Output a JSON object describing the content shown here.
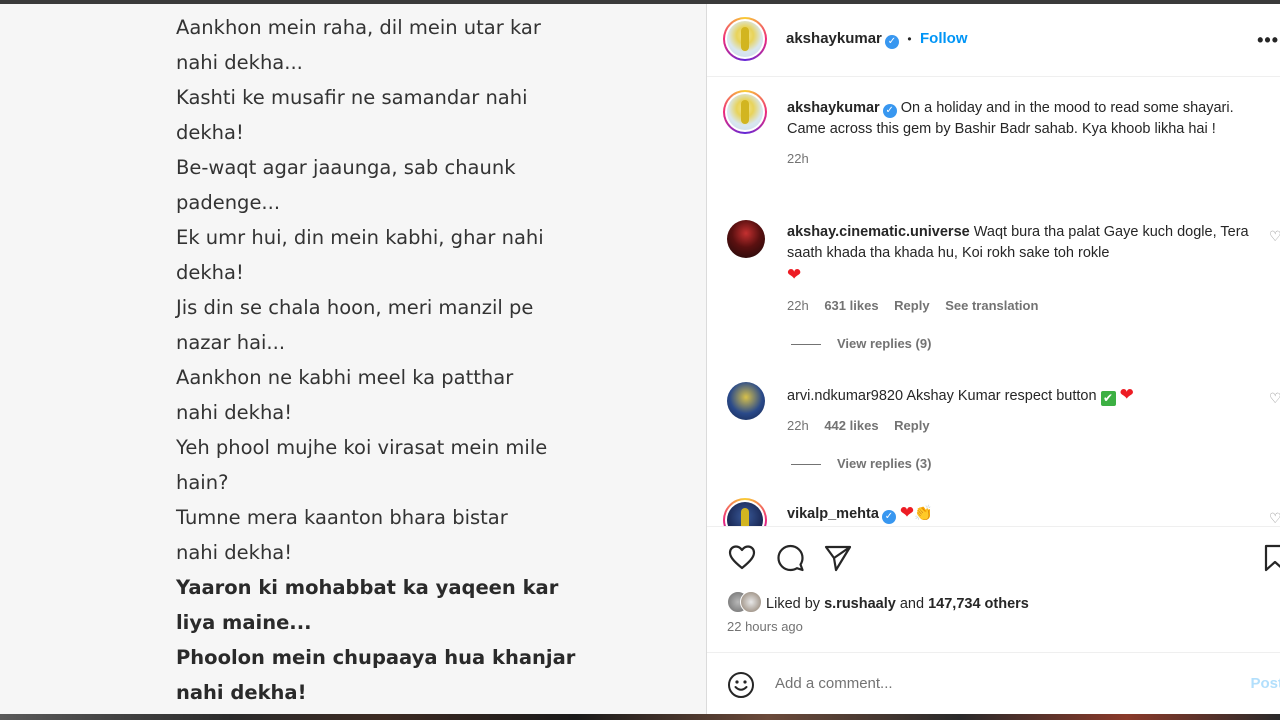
{
  "poem": {
    "lines": [
      {
        "text": "Aankhon mein raha, dil mein utar kar",
        "bold": false
      },
      {
        "text": "nahi dekha...",
        "bold": false
      },
      {
        "text": "Kashti ke musafir ne samandar nahi",
        "bold": false
      },
      {
        "text": "dekha!",
        "bold": false
      },
      {
        "text": "Be-waqt agar jaaunga, sab chaunk",
        "bold": false
      },
      {
        "text": "padenge...",
        "bold": false
      },
      {
        "text": "Ek umr hui, din mein kabhi, ghar nahi",
        "bold": false
      },
      {
        "text": "dekha!",
        "bold": false
      },
      {
        "text": "Jis din se chala hoon, meri manzil pe",
        "bold": false
      },
      {
        "text": "nazar hai...",
        "bold": false
      },
      {
        "text": "Aankhon ne kabhi meel ka patthar",
        "bold": false
      },
      {
        "text": "nahi dekha!",
        "bold": false
      },
      {
        "text": "Yeh phool mujhe koi virasat mein mile",
        "bold": false
      },
      {
        "text": "hain?",
        "bold": false
      },
      {
        "text": "Tumne mera kaanton bhara bistar",
        "bold": false
      },
      {
        "text": "nahi dekha!",
        "bold": false
      },
      {
        "text": "Yaaron ki mohabbat ka yaqeen kar",
        "bold": true
      },
      {
        "text": "liya maine...",
        "bold": true
      },
      {
        "text": "Phoolon mein chupaaya hua khanjar",
        "bold": true
      },
      {
        "text": "nahi dekha!",
        "bold": true
      }
    ]
  },
  "header": {
    "username": "akshaykumar",
    "separator": "•",
    "follow_label": "Follow",
    "more_label": "•••"
  },
  "caption": {
    "username": "akshaykumar",
    "text": "On a holiday and in the mood to read some shayari. Came across this gem by Bashir Badr sahab. Kya khoob likha hai !",
    "time": "22h"
  },
  "comments": [
    {
      "username": "akshay.cinematic.universe",
      "text": "Waqt bura tha palat Gaye kuch dogle, Tera saath khada tha khada hu, Koi rokh sake toh rokle",
      "emoji": "❤",
      "time": "22h",
      "likes": "631 likes",
      "reply_label": "Reply",
      "translation_label": "See translation",
      "view_replies": "View replies (9)"
    },
    {
      "username": "arvi.ndkumar9820",
      "text": "Akshay Kumar respect button",
      "emoji_check": "✔",
      "emoji": "❤",
      "time": "22h",
      "likes": "442 likes",
      "reply_label": "Reply",
      "view_replies": "View replies (3)"
    },
    {
      "username": "vikalp_mehta",
      "emoji": "❤",
      "emoji2": "👏"
    }
  ],
  "likes": {
    "prefix": "Liked by",
    "first_user": "s.rushaaly",
    "and": "and",
    "others": "147,734 others"
  },
  "post_time": "22 hours ago",
  "add_comment": {
    "placeholder": "Add a comment...",
    "post_label": "Post"
  },
  "colors": {
    "link_blue": "#0095f6",
    "verified_blue": "#3897f0",
    "heart_red": "#ed1c24",
    "muted": "#737373"
  },
  "icons": [
    "heart-icon",
    "comment-icon",
    "share-icon",
    "bookmark-icon",
    "emoji-icon",
    "verified-icon",
    "more-icon"
  ]
}
